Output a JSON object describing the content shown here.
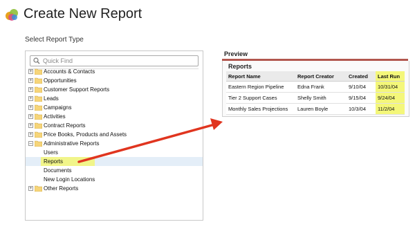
{
  "header": {
    "title": "Create New Report",
    "subtitle": "Select Report Type"
  },
  "search": {
    "placeholder": "Quick Find",
    "icon": "magnifier-icon"
  },
  "tree": {
    "items": [
      {
        "label": "Accounts & Contacts",
        "type": "folder",
        "expanded": false
      },
      {
        "label": "Opportunities",
        "type": "folder",
        "expanded": false
      },
      {
        "label": "Customer Support Reports",
        "type": "folder",
        "expanded": false
      },
      {
        "label": "Leads",
        "type": "folder",
        "expanded": false
      },
      {
        "label": "Campaigns",
        "type": "folder",
        "expanded": false
      },
      {
        "label": "Activities",
        "type": "folder",
        "expanded": false
      },
      {
        "label": "Contract Reports",
        "type": "folder",
        "expanded": false
      },
      {
        "label": "Price Books, Products and Assets",
        "type": "folder",
        "expanded": false
      },
      {
        "label": "Administrative Reports",
        "type": "folder",
        "expanded": true
      },
      {
        "label": "Users",
        "type": "leaf"
      },
      {
        "label": "Reports",
        "type": "leaf",
        "selected": true
      },
      {
        "label": "Documents",
        "type": "leaf"
      },
      {
        "label": "New Login Locations",
        "type": "leaf"
      },
      {
        "label": "Other Reports",
        "type": "folder",
        "expanded": false
      }
    ]
  },
  "preview": {
    "title": "Preview",
    "heading": "Reports",
    "columns": [
      "Report Name",
      "Report Creator",
      "Created",
      "Last Run"
    ],
    "rows": [
      [
        "Eastern Region Pipeline",
        "Edna Frank",
        "9/10/04",
        "10/31/04"
      ],
      [
        "Tier 2 Support Cases",
        "Shelly Smith",
        "9/15/04",
        "9/24/04"
      ],
      [
        "Monthly Sales Projections",
        "Lauren Boyle",
        "10/3/04",
        "11/2/04"
      ]
    ]
  },
  "colors": {
    "highlight": "#f4f77a",
    "arrow": "#e0351f",
    "preview_rule": "#b2574f",
    "selected_row": "#e4eef8"
  }
}
